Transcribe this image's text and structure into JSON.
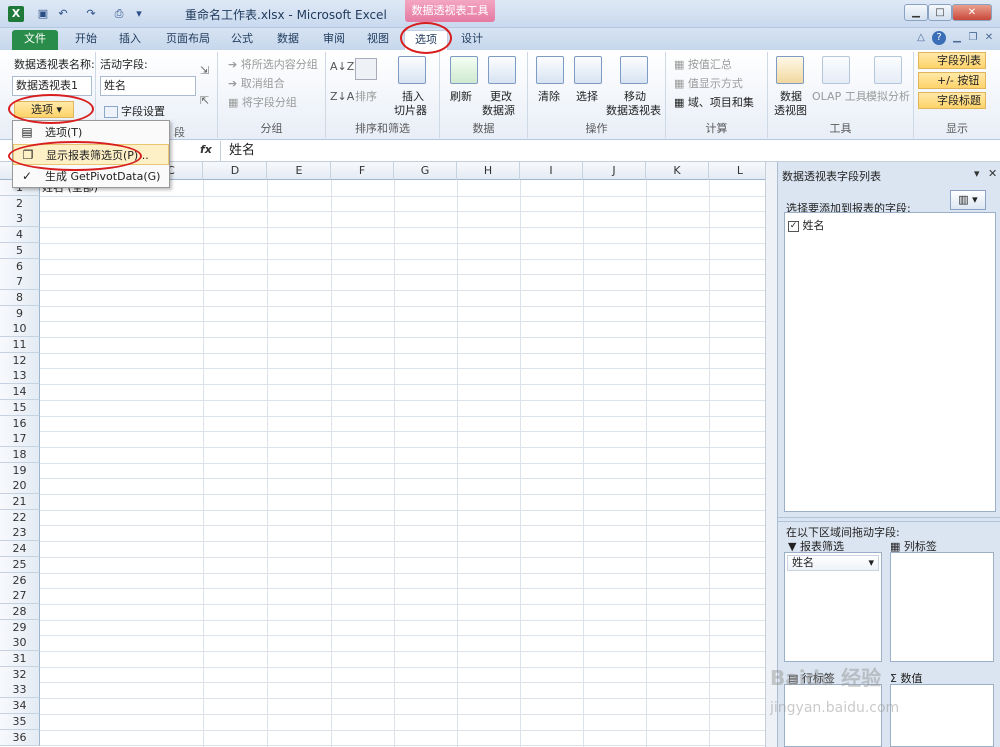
{
  "window": {
    "title": "重命名工作表.xlsx - Microsoft Excel",
    "contextual_tab_group": "数据透视表工具",
    "app_icon": "X",
    "controls": {
      "minimize": "▁",
      "maximize": "□",
      "close": "✕"
    }
  },
  "ribbon_tabs": [
    "文件",
    "开始",
    "插入",
    "页面布局",
    "公式",
    "数据",
    "审阅",
    "视图",
    "选项",
    "设计"
  ],
  "ribbon": {
    "pivot_name_label": "数据透视表名称:",
    "pivot_name_value": "数据透视表1",
    "options_button": "选项",
    "active_field_label": "活动字段:",
    "active_field_value": "姓名",
    "field_settings": "字段设置",
    "active_field_group_label": "段",
    "group_items": [
      "将所选内容分组",
      "取消组合",
      "将字段分组"
    ],
    "group_label": "分组",
    "sort_label": "排序",
    "insert_slicer": [
      "插入",
      "切片器"
    ],
    "sort_filter_label": "排序和筛选",
    "refresh": "刷新",
    "change_source": [
      "更改",
      "数据源"
    ],
    "data_label": "数据",
    "clear": "清除",
    "select": "选择",
    "move_pivot": [
      "移动",
      "数据透视表"
    ],
    "actions_label": "操作",
    "calc_items": [
      "按值汇总",
      "值显示方式",
      "域、项目和集"
    ],
    "calc_label": "计算",
    "pivot_chart": [
      "数据",
      "透视图"
    ],
    "olap": "OLAP 工具",
    "what_if": "模拟分析",
    "tools_label": "工具",
    "show_items": [
      "字段列表",
      "+/- 按钮",
      "字段标题"
    ],
    "show_label": "显示"
  },
  "dropdown_menu": {
    "items": [
      {
        "label": "选项(T)",
        "icon": "options-icon"
      },
      {
        "label": "显示报表筛选页(P)...",
        "icon": "pages-icon"
      },
      {
        "label": "生成 GetPivotData(G)",
        "icon": "check-icon"
      }
    ]
  },
  "formula_bar": {
    "fx": "fx",
    "value": "姓名"
  },
  "sheet": {
    "columns": [
      "C",
      "D",
      "E",
      "F",
      "G",
      "H",
      "I",
      "J",
      "K",
      "L"
    ],
    "rows": [
      "1",
      "2",
      "3",
      "4",
      "5",
      "6",
      "7",
      "8",
      "9",
      "10",
      "11",
      "12",
      "13",
      "14",
      "15",
      "16",
      "17",
      "18",
      "19",
      "20",
      "21",
      "22",
      "23",
      "24",
      "25",
      "26",
      "27",
      "28",
      "29",
      "30",
      "31",
      "32",
      "33",
      "34",
      "35",
      "36"
    ],
    "a1_value": "姓名  (全部)"
  },
  "field_list": {
    "title": "数据透视表字段列表",
    "choose_label": "选择要添加到报表的字段:",
    "fields": [
      {
        "name": "姓名",
        "checked": true
      }
    ],
    "drag_label": "在以下区域间拖动字段:",
    "report_filter": "报表筛选",
    "column_labels": "列标签",
    "row_labels": "行标签",
    "values": "数值",
    "filter_field": "姓名"
  },
  "watermark": {
    "brand": "Baidu 经验",
    "url": "jingyan.baidu.com"
  }
}
